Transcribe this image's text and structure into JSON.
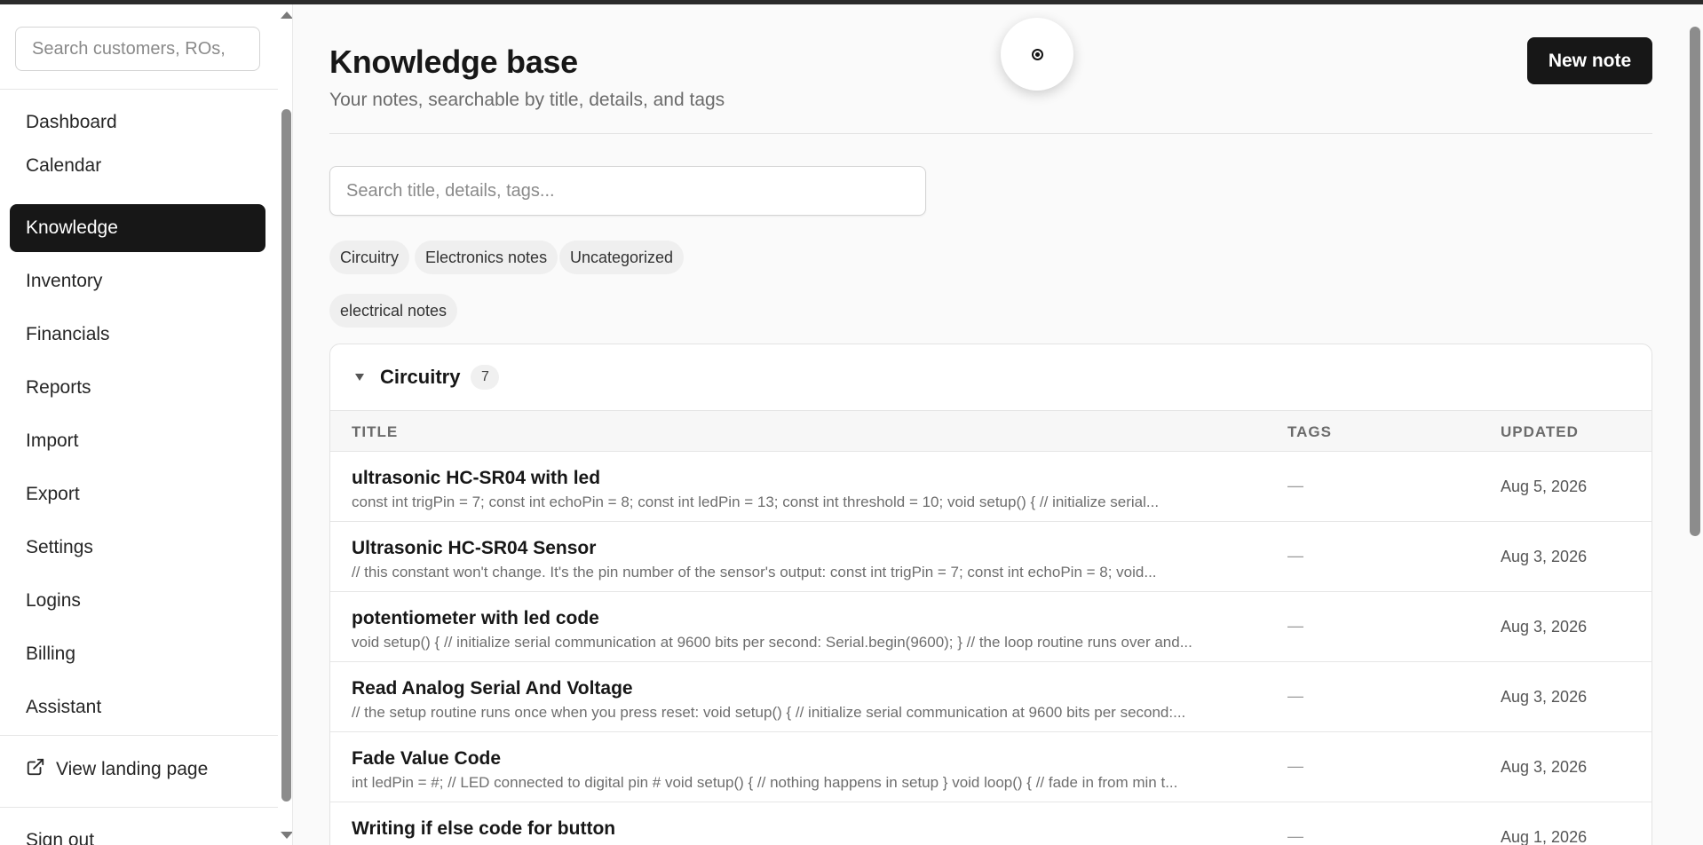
{
  "sidebar": {
    "search_placeholder": "Search customers, ROs,",
    "items": [
      {
        "label": "Dashboard"
      },
      {
        "label": "Calendar"
      },
      {
        "label": "Knowledge"
      },
      {
        "label": "Inventory"
      },
      {
        "label": "Financials"
      },
      {
        "label": "Reports"
      },
      {
        "label": "Import"
      },
      {
        "label": "Export"
      },
      {
        "label": "Settings"
      },
      {
        "label": "Logins"
      },
      {
        "label": "Billing"
      },
      {
        "label": "Assistant"
      }
    ],
    "active_item": "Knowledge",
    "landing_link": "View landing page",
    "signout": "Sign out"
  },
  "header": {
    "title": "Knowledge base",
    "subtitle": "Your notes, searchable by title, details, and tags",
    "new_note_label": "New note"
  },
  "search": {
    "placeholder": "Search title, details, tags..."
  },
  "chips": [
    "Circuitry",
    "Electronics notes",
    "Uncategorized",
    "electrical notes"
  ],
  "group": {
    "title": "Circuitry",
    "count": "7",
    "columns": {
      "title": "TITLE",
      "tags": "TAGS",
      "updated": "UPDATED"
    },
    "rows": [
      {
        "title": "ultrasonic HC-SR04 with led",
        "snippet": "const int trigPin = 7; const int echoPin = 8; const int ledPin = 13; const int threshold = 10; void setup() { // initialize serial...",
        "tags": "—",
        "updated": "Aug 5, 2026"
      },
      {
        "title": "Ultrasonic HC-SR04 Sensor",
        "snippet": "// this constant won't change. It's the pin number of the sensor's output: const int trigPin = 7; const int echoPin = 8; void...",
        "tags": "—",
        "updated": "Aug 3, 2026"
      },
      {
        "title": "potentiometer with led code",
        "snippet": "void setup() { // initialize serial communication at 9600 bits per second: Serial.begin(9600); } // the loop routine runs over and...",
        "tags": "—",
        "updated": "Aug 3, 2026"
      },
      {
        "title": "Read Analog Serial And Voltage",
        "snippet": "// the setup routine runs once when you press reset: void setup() { // initialize serial communication at 9600 bits per second:...",
        "tags": "—",
        "updated": "Aug 3, 2026"
      },
      {
        "title": "Fade Value Code",
        "snippet": "int ledPin = #; // LED connected to digital pin # void setup() { // nothing happens in setup } void loop() { // fade in from min t...",
        "tags": "—",
        "updated": "Aug 3, 2026"
      },
      {
        "title": "Writing if else code for button",
        "snippet": "",
        "tags": "—",
        "updated": "Aug 1, 2026"
      }
    ]
  },
  "icons": {
    "external_link": "external-link-icon",
    "collapse": "triangle-down-icon",
    "assistant": "record-icon"
  },
  "colors": {
    "accent": "#171717",
    "background": "#fafafa"
  }
}
